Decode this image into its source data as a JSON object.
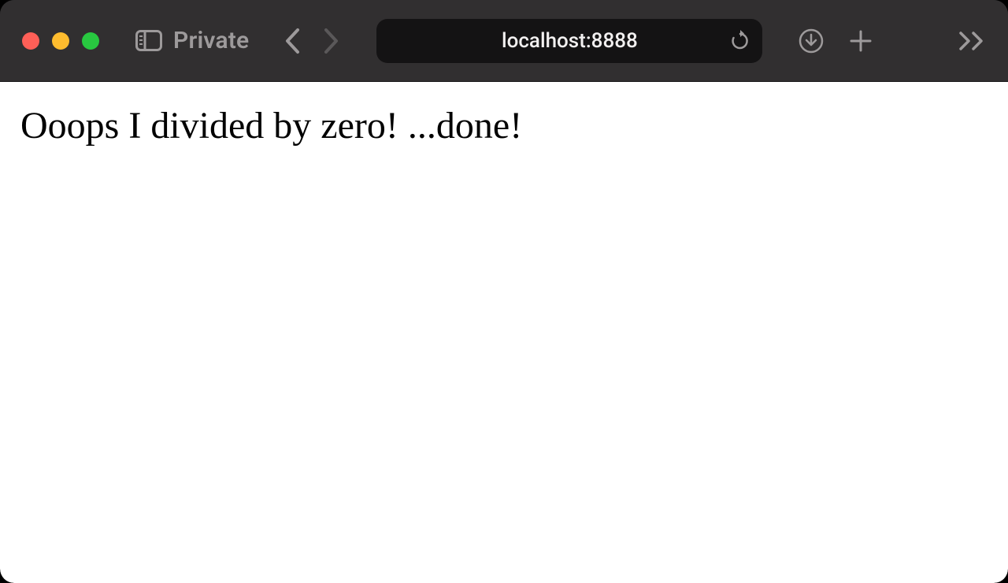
{
  "toolbar": {
    "private_label": "Private",
    "address": "localhost:8888"
  },
  "page": {
    "body_text": "Ooops I divided by zero! ...done!"
  }
}
